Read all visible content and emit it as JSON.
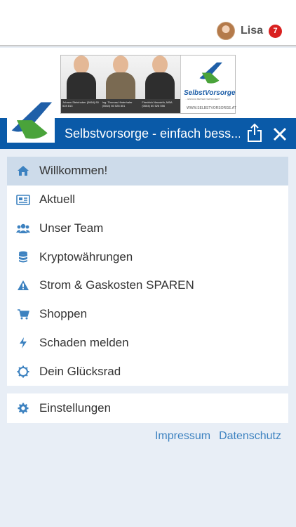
{
  "user": {
    "name": "Lisa",
    "notifications": "7"
  },
  "banner": {
    "captions": [
      "Johann Steinhuber (0664) 80 528 813",
      "Ing. Thomas Hinterhaler (0664) 80 528 801",
      "Friedrich Neuwirth, MBA (0664) 80 528 556"
    ],
    "brand": "SelbstVorsorge",
    "tagline": "... EINFACH BESSER VERSICHERT",
    "url": "WWW.SELBSTVORSORGE.AT"
  },
  "titlebar": {
    "title": "Selbstvorsorge - einfach bess..."
  },
  "menu": {
    "items": [
      {
        "label": "Willkommen!",
        "icon": "home-icon",
        "active": true
      },
      {
        "label": "Aktuell",
        "icon": "newspaper-icon"
      },
      {
        "label": "Unser Team",
        "icon": "users-icon"
      },
      {
        "label": "Kryptowährungen",
        "icon": "database-icon"
      },
      {
        "label": "Strom & Gaskosten SPAREN",
        "icon": "warning-icon"
      },
      {
        "label": "Shoppen",
        "icon": "cart-icon"
      },
      {
        "label": "Schaden melden",
        "icon": "bolt-icon"
      },
      {
        "label": "Dein Glücksrad",
        "icon": "wheel-icon"
      }
    ],
    "settings": {
      "label": "Einstellungen",
      "icon": "gear-icon"
    }
  },
  "footer": {
    "impressum": "Impressum",
    "datenschutz": "Datenschutz"
  },
  "colors": {
    "primary": "#0a5aa8",
    "active_bg": "#cddbea",
    "icon": "#3d82c0",
    "badge": "#d9201f",
    "link": "#3d82c0"
  }
}
